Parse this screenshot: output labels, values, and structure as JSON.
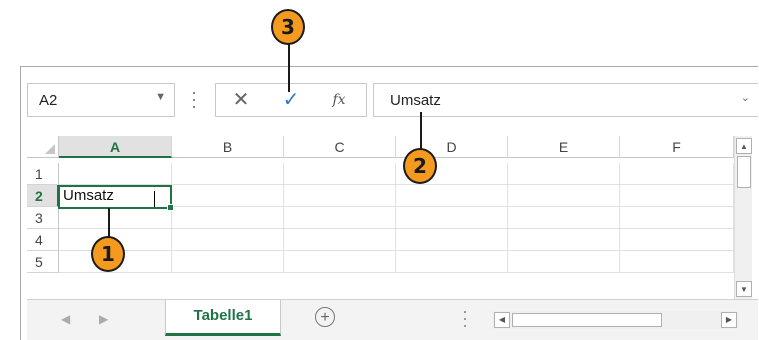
{
  "formula_bar": {
    "name_box": "A2",
    "cancel_glyph": "✕",
    "enter_glyph": "✓",
    "fx_label": "fx",
    "formula_value": "Umsatz"
  },
  "columns": [
    "A",
    "B",
    "C",
    "D",
    "E",
    "F"
  ],
  "rows": [
    "1",
    "2",
    "3",
    "4",
    "5"
  ],
  "active_cell": {
    "ref": "A2",
    "value": "Umsatz"
  },
  "sheet_tabs": [
    "Tabelle1"
  ],
  "add_sheet_glyph": "+",
  "callouts": [
    "1",
    "2",
    "3"
  ],
  "colors": {
    "accent": "#217346",
    "callout": "#f39a1f",
    "enter": "#2b7cd3"
  },
  "icons": [
    "chevron-down-icon",
    "cancel-icon",
    "enter-check-icon",
    "function-icon",
    "add-sheet-icon",
    "scroll-up-icon",
    "scroll-down-icon",
    "scroll-left-icon",
    "scroll-right-icon"
  ]
}
